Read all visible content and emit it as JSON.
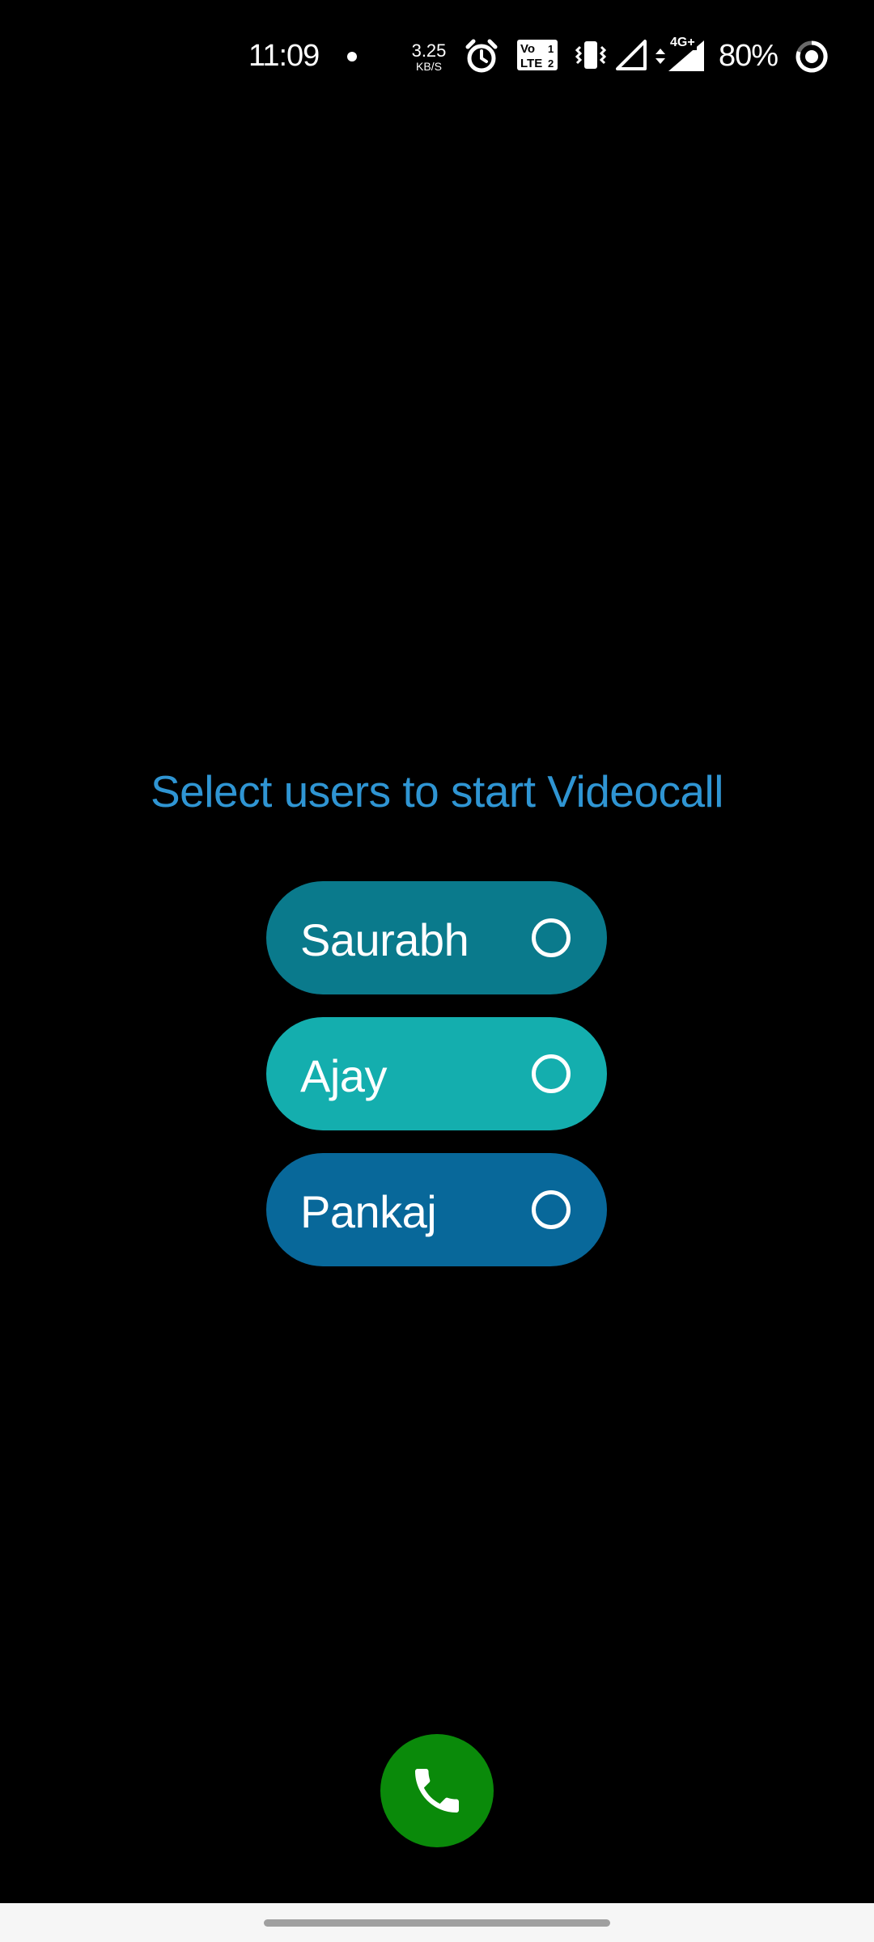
{
  "status_bar": {
    "time": "11:09",
    "net_speed_value": "3.25",
    "net_speed_unit": "KB/S",
    "volte_top": "Vo",
    "volte_bottom": "LTE",
    "network_label": "4G+",
    "battery_percent": "80%"
  },
  "title": "Select users to start Videocall",
  "users": [
    {
      "name": "Saurabh",
      "color": "#0a7a8c",
      "selected": false
    },
    {
      "name": "Ajay",
      "color": "#14aeae",
      "selected": false
    },
    {
      "name": "Pankaj",
      "color": "#08689a",
      "selected": false
    }
  ],
  "colors": {
    "background": "#000000",
    "title": "#2f95d3",
    "call_button": "#0a8a0a"
  },
  "icons": {
    "call": "phone-icon"
  }
}
